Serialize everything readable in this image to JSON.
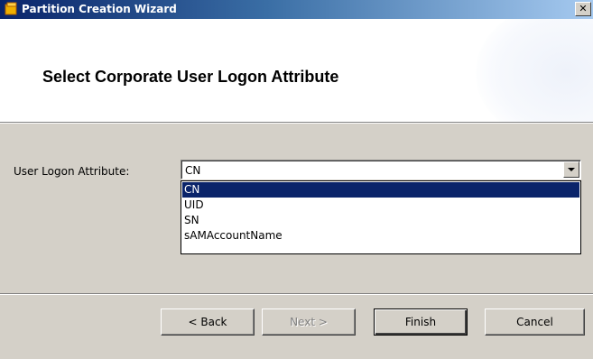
{
  "window": {
    "title": "Partition Creation Wizard",
    "close_label": "✕"
  },
  "header": {
    "title": "Select Corporate User Logon Attribute"
  },
  "form": {
    "logon_label": "User Logon Attribute:",
    "logon_value": "CN",
    "options": [
      "CN",
      "UID",
      "SN",
      "sAMAccountName"
    ],
    "selected_index": 0
  },
  "buttons": {
    "back": "< Back",
    "next": "Next >",
    "finish": "Finish",
    "cancel": "Cancel"
  }
}
